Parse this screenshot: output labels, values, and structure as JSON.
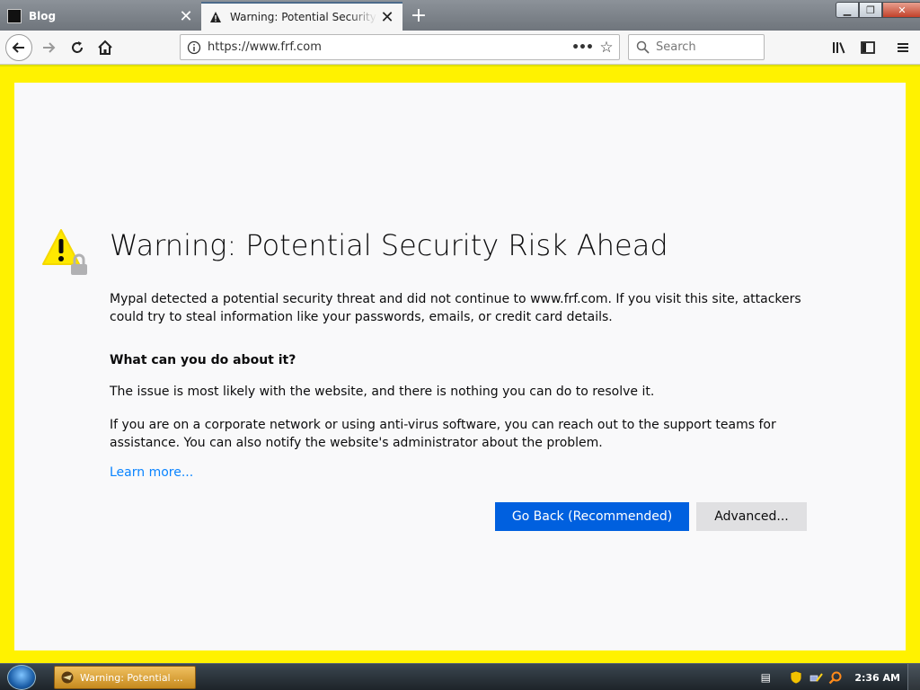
{
  "tabs": [
    {
      "title": "Blog",
      "active": false
    },
    {
      "title": "Warning: Potential Security Risk Ahead",
      "active": true
    }
  ],
  "navbar": {
    "url": "https://www.frf.com",
    "search_placeholder": "Search"
  },
  "content": {
    "title": "Warning: Potential Security Risk Ahead",
    "intro": "Mypal detected a potential security threat and did not continue to www.frf.com. If you visit this site, attackers could try to steal information like your passwords, emails, or credit card details.",
    "question": "What can you do about it?",
    "issue": "The issue is most likely with the website, and there is nothing you can do to resolve it.",
    "corporate": "If you are on a corporate network or using anti-virus software, you can reach out to the support teams for assistance. You can also notify the website's administrator about the problem.",
    "learn_more": "Learn more...",
    "go_back_label": "Go Back (Recommended)",
    "advanced_label": "Advanced..."
  },
  "taskbar": {
    "window_label": "Warning: Potential ...",
    "clock": "2:36 AM"
  },
  "colors": {
    "frame_border": "#fff200",
    "primary_button": "#0060df",
    "link": "#0a84ff"
  }
}
